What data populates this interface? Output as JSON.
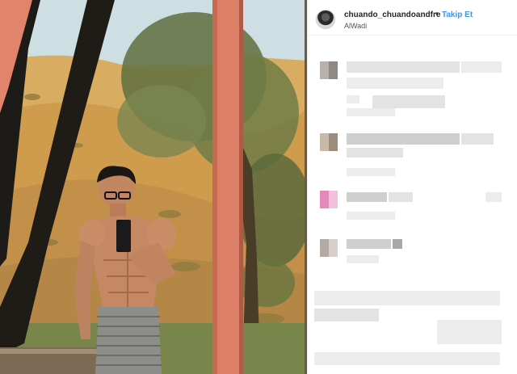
{
  "post": {
    "username": "chuando_chuandoandfre",
    "separator": "•",
    "follow_label": "Takip Et",
    "location": "AlWadi"
  },
  "colors": {
    "follow_blue": "#3897f0",
    "frame_orange": "#e0826a",
    "comment_avatar_pink": "#e38ab8"
  },
  "comments_note_visible": false
}
